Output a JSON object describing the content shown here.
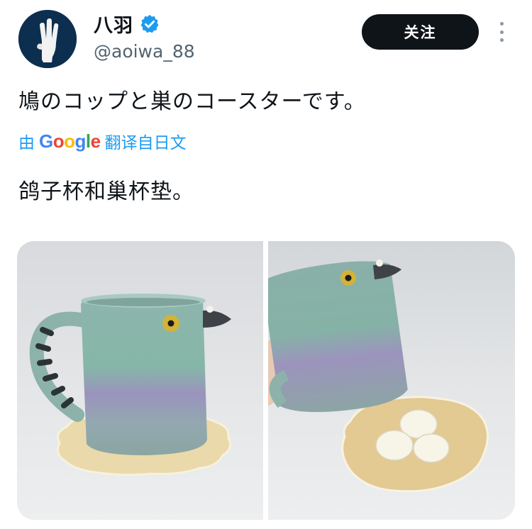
{
  "user": {
    "display_name": "八羽",
    "handle": "@aoiwa_88",
    "verified_icon": "verified-badge-icon",
    "avatar_icon": "hand-avatar"
  },
  "actions": {
    "follow_label": "关注",
    "more_icon": "more-vertical-icon"
  },
  "tweet": {
    "text": "鳩のコップと巣のコースターです。",
    "translation": {
      "prefix": "由",
      "provider": "Google",
      "suffix": "翻译自日文",
      "text": "鸽子杯和巢杯垫。"
    }
  },
  "colors": {
    "follow_bg": "#0f1419",
    "link": "#1d9bf0",
    "verified": "#1d9bf0",
    "handle": "#536471"
  }
}
